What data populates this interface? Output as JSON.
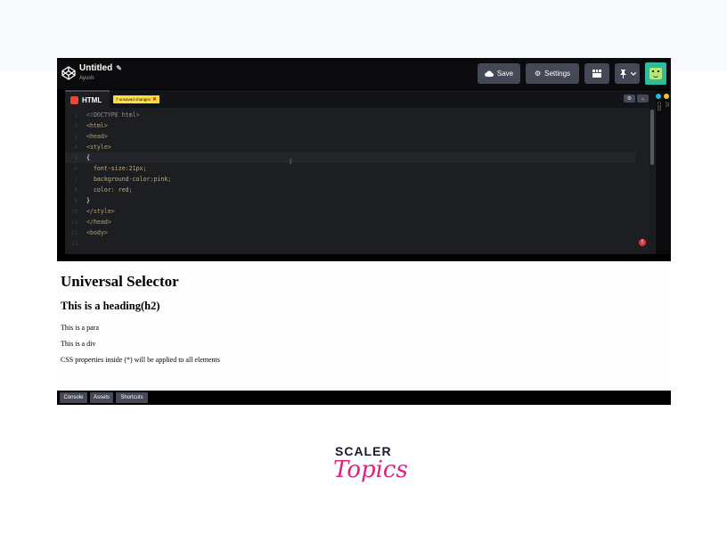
{
  "app": {
    "title": "Untitled",
    "author": "Ayush",
    "buttons": {
      "save": "Save",
      "settings": "Settings"
    }
  },
  "editor": {
    "tab_label": "HTML",
    "unsaved_badge": "7 unsaved changes",
    "lines": [
      {
        "n": "1",
        "text": "<!DOCTYPE html>"
      },
      {
        "n": "2",
        "text": "<html>"
      },
      {
        "n": "3",
        "text": "<head>"
      },
      {
        "n": "4",
        "text": "<style>"
      },
      {
        "n": "5",
        "text": "{"
      },
      {
        "n": "6",
        "text": "  font-size:21px;"
      },
      {
        "n": "7",
        "text": "  background-color:pink;"
      },
      {
        "n": "8",
        "text": "  color: red;"
      },
      {
        "n": "9",
        "text": "}"
      },
      {
        "n": "10",
        "text": "</style>"
      },
      {
        "n": "11",
        "text": "</head>"
      },
      {
        "n": "12",
        "text": "<body>"
      },
      {
        "n": "13",
        "text": ""
      }
    ],
    "error_marker": "!",
    "side_labels": [
      "CSS",
      "JS"
    ]
  },
  "preview": {
    "h1": "Universal Selector",
    "h2": "This is a heading(h2)",
    "para": "This is a para",
    "div": "This is a div",
    "note": "CSS properties inside (*) will be applied to all elements"
  },
  "footer": {
    "console": "Console",
    "assets": "Assets",
    "shortcuts": "Shortcuts"
  },
  "brand": {
    "top": "SCALER",
    "bottom": "Topics"
  },
  "colors": {
    "accent_pink": "#e0217f",
    "unsaved_yellow": "#ffdd40",
    "button_gray": "#444857"
  }
}
